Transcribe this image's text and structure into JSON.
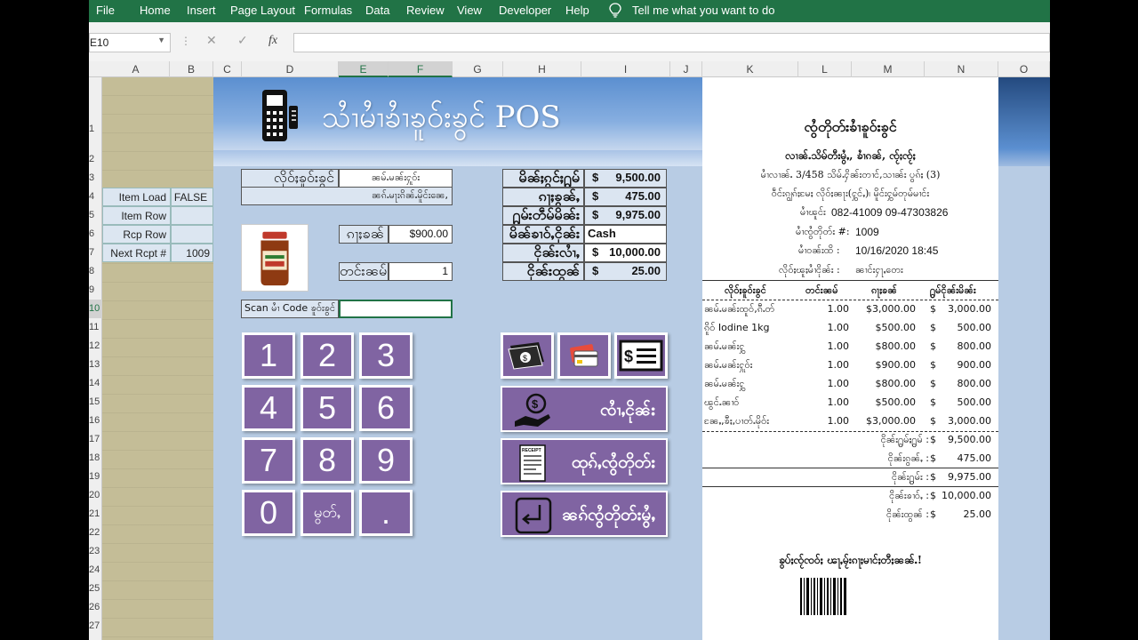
{
  "ribbon": {
    "tabs": [
      "File",
      "Home",
      "Insert",
      "Page Layout",
      "Formulas",
      "Data",
      "Review",
      "View",
      "Developer",
      "Help"
    ],
    "tell_me": "Tell me what you want to do"
  },
  "formula_bar": {
    "name_box": "E10",
    "fx": "fx",
    "formula": ""
  },
  "columns": [
    "A",
    "B",
    "C",
    "D",
    "E",
    "F",
    "G",
    "H",
    "I",
    "J",
    "K",
    "L",
    "M",
    "N",
    "O"
  ],
  "rows": [
    "1",
    "2",
    "3",
    "4",
    "5",
    "6",
    "7",
    "8",
    "9",
    "10",
    "11",
    "12",
    "13",
    "14",
    "15",
    "16",
    "17",
    "18",
    "19",
    "20",
    "21",
    "22",
    "23",
    "24",
    "25",
    "26",
    "27"
  ],
  "info_table": [
    {
      "label": "Item Load",
      "value": "FALSE"
    },
    {
      "label": "Item Row",
      "value": ""
    },
    {
      "label": "Rcp Row",
      "value": ""
    },
    {
      "label": "Next Rcpt #",
      "value": "1009"
    }
  ],
  "pos": {
    "title": "သၢႆမၢႆၶၢႆၶူဝ်းၶွင် POS",
    "item_name_label": "လိုဝ်ႈၶူဝ်းၶွင်",
    "item_name_value": "ၼမ်ႉမၼ်းႁူဝ်း",
    "item_desc_value": "ၼၵ်ႉမႃးၵိၼ်ႉမိူင်းၼေ,",
    "price_label": "ၵႃႈၶၼ်",
    "price_value": "$900.00",
    "qty_label": "တင်းၼမ်",
    "qty_value": "1",
    "scan_label": "Scan မၢႆ Code ၶူဝ်းၶွင်",
    "scan_value": "",
    "summary": [
      {
        "label": "မိၼ်ႈၵွင်ႈ႐ွမ်",
        "currency": "$",
        "amount": "9,500.00"
      },
      {
        "label": "ၵႃႈၶွၼ်ႇ",
        "currency": "$",
        "amount": "475.00"
      },
      {
        "label": "႐ွမ်းတဵမ်မိၼ်း",
        "currency": "$",
        "amount": "9,975.00"
      },
      {
        "label": "မိၼ်ၶၢဝ်ႇငိုၼ်း",
        "currency": "",
        "amount": "Cash"
      },
      {
        "label": "ငိုၼ်းလၢႆႇ",
        "currency": "$",
        "amount": "10,000.00"
      },
      {
        "label": "ငိုၼ်းထွၼ်",
        "currency": "$",
        "amount": "25.00"
      }
    ],
    "keypad": [
      "1",
      "2",
      "3",
      "4",
      "5",
      "6",
      "7",
      "8",
      "9",
      "0",
      "မွတ်ႇ",
      "."
    ],
    "pay_buttons": [
      "cash-icon",
      "card-icon",
      "check-icon"
    ],
    "actions": [
      {
        "label": "ၸၢႆႇငိုၼ်း",
        "icon": "pay-hand-icon"
      },
      {
        "label": "ထုၵ်ႇၸွႆတိုတ်း",
        "icon": "receipt-print-icon"
      },
      {
        "label": "ၼၵ်ၸွႆတိုတ်းမွႆႇ",
        "icon": "return-icon"
      }
    ]
  },
  "receipt": {
    "title": "ၸွႆတိုတ်းၶၢႆၶူဝ်းၶွင်",
    "shop": "လၢၼ်ႉသိမ်တီးမွႆႇ, ၶၢႆၵၼ်, ၸႂ်ႈၸႂ်ႈ",
    "address": "မၢႆလၢၼ်ႉ 3/458 သိမ်ႉႁိၼ်းတၢင်,သၢၼ်း ပွၵ်ႈ (3)",
    "township": "ဝဵင်းၵျွၵ်ႈမႄႈ လိုဝ်ႈၼႃး(ႁွင်ႇ)၊ မိူင်းႁွမ်တုမ်မၢင်း",
    "phone_label": "မၢႆၽူင်း",
    "phone": "082-41009 09-47303826",
    "receipt_no_label": "မၢႆၸွႆတိုတ်း #:",
    "receipt_no": "1009",
    "date_label": "မၢႆဝၼ်းထိ :",
    "date": "10/16/2020 18:45",
    "customer_label": "လိုဝ်ႈၽူႈမၢႆငိုၼ်း :",
    "customer": "ၼၢင်းႁႃႇတေး",
    "headers": [
      "လိုဝ်ႈၶူဝ်းၶွင်",
      "တင်းၼမ်",
      "ၵႃႈၶၼ်",
      "႐ွမ်ငိုၼ်းမိၼ်း"
    ],
    "items": [
      {
        "name": "ၼမ်ႉမၼ်းထူဝ်,ၵီႉတ်",
        "qty": "1.00",
        "price": "$3,000.00",
        "cur": "$",
        "total": "3,000.00"
      },
      {
        "name": "ၵိူဝ် Iodine 1kg",
        "qty": "1.00",
        "price": "$500.00",
        "cur": "$",
        "total": "500.00"
      },
      {
        "name": "ၼမ်ႉမၼ်းႁွ",
        "qty": "1.00",
        "price": "$800.00",
        "cur": "$",
        "total": "800.00"
      },
      {
        "name": "ၼမ်ႉမၼ်းႁူဝ်း",
        "qty": "1.00",
        "price": "$900.00",
        "cur": "$",
        "total": "900.00"
      },
      {
        "name": "ၼမ်ႉမၼ်းႁွ",
        "qty": "1.00",
        "price": "$800.00",
        "cur": "$",
        "total": "800.00"
      },
      {
        "name": "ၽွင်ႉၼၢဝ်",
        "qty": "1.00",
        "price": "$500.00",
        "cur": "$",
        "total": "500.00"
      },
      {
        "name": "ၼႄႇ,ၶီႈ,ပၢတ်ႉမိုဝ်း",
        "qty": "1.00",
        "price": "$3,000.00",
        "cur": "$",
        "total": "3,000.00"
      }
    ],
    "totals": [
      {
        "label": "ငိုၼ်း႐ွမ်ႈ႐ွမ် :",
        "cur": "$",
        "amount": "9,500.00"
      },
      {
        "label": "ငိုၼ်းၵွၼ်ႇ :",
        "cur": "$",
        "amount": "475.00"
      },
      {
        "label": "ငိုၼ်း႐ွမ်း :",
        "cur": "$",
        "amount": "9,975.00"
      },
      {
        "label": "ငိုၼ်းၶၢဝ်ႇ :",
        "cur": "$",
        "amount": "10,000.00"
      },
      {
        "label": "ငိုၼ်းထွၼ် :",
        "cur": "$",
        "amount": "25.00"
      }
    ],
    "thanks": "ၶွပ်ႈၸႂ်ၸဝ်ႈ ၽႃႇမႂ်းၵႃႈမၢင်ႈတီႈၼၼ်ႉ!"
  }
}
